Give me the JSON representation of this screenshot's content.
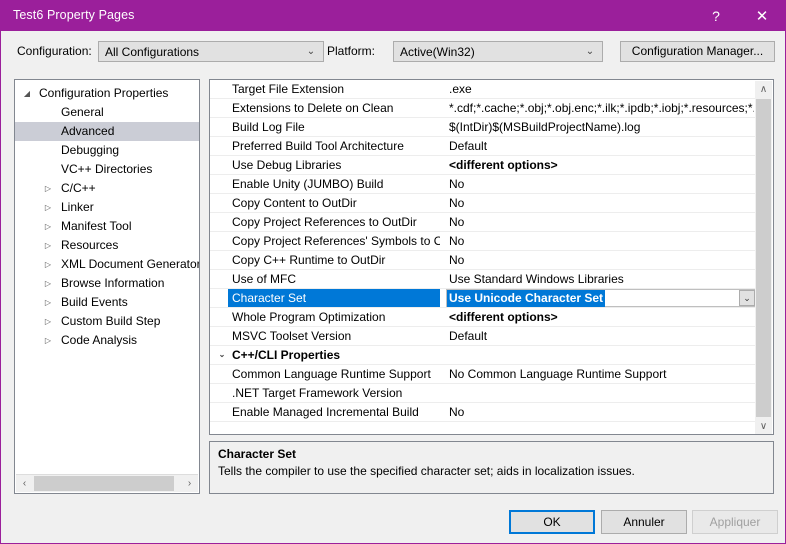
{
  "window": {
    "title": "Test6 Property Pages",
    "help_icon": "?",
    "close_icon": "✕",
    "accent_color": "#9B1F9B",
    "selection_color": "#0078D7"
  },
  "toolbar": {
    "configuration_label": "Configuration:",
    "configuration_value": "All Configurations",
    "platform_label": "Platform:",
    "platform_value": "Active(Win32)",
    "configuration_manager_label": "Configuration Manager...",
    "dropdown_arrow": "⌄"
  },
  "tree": {
    "items": [
      {
        "label": "Configuration Properties",
        "level": 0,
        "twisty": "◢",
        "selected": false
      },
      {
        "label": "General",
        "level": 1,
        "twisty": "",
        "selected": false
      },
      {
        "label": "Advanced",
        "level": 1,
        "twisty": "",
        "selected": true
      },
      {
        "label": "Debugging",
        "level": 1,
        "twisty": "",
        "selected": false
      },
      {
        "label": "VC++ Directories",
        "level": 1,
        "twisty": "",
        "selected": false
      },
      {
        "label": "C/C++",
        "level": 1,
        "twisty": "▷",
        "selected": false
      },
      {
        "label": "Linker",
        "level": 1,
        "twisty": "▷",
        "selected": false
      },
      {
        "label": "Manifest Tool",
        "level": 1,
        "twisty": "▷",
        "selected": false
      },
      {
        "label": "Resources",
        "level": 1,
        "twisty": "▷",
        "selected": false
      },
      {
        "label": "XML Document Generator",
        "level": 1,
        "twisty": "▷",
        "selected": false
      },
      {
        "label": "Browse Information",
        "level": 1,
        "twisty": "▷",
        "selected": false
      },
      {
        "label": "Build Events",
        "level": 1,
        "twisty": "▷",
        "selected": false
      },
      {
        "label": "Custom Build Step",
        "level": 1,
        "twisty": "▷",
        "selected": false
      },
      {
        "label": "Code Analysis",
        "level": 1,
        "twisty": "▷",
        "selected": false
      }
    ],
    "hscroll": {
      "left_arrow": "‹",
      "right_arrow": "›"
    }
  },
  "grid": {
    "rows": [
      {
        "name": "Target File Extension",
        "value": ".exe",
        "kind": "prop",
        "bold": false,
        "selected": false
      },
      {
        "name": "Extensions to Delete on Clean",
        "value": "*.cdf;*.cache;*.obj;*.obj.enc;*.ilk;*.ipdb;*.iobj;*.resources;*.t",
        "kind": "prop",
        "bold": false,
        "selected": false
      },
      {
        "name": "Build Log File",
        "value": "$(IntDir)$(MSBuildProjectName).log",
        "kind": "prop",
        "bold": false,
        "selected": false
      },
      {
        "name": "Preferred Build Tool Architecture",
        "value": "Default",
        "kind": "prop",
        "bold": false,
        "selected": false
      },
      {
        "name": "Use Debug Libraries",
        "value": "<different options>",
        "kind": "prop",
        "bold": true,
        "selected": false
      },
      {
        "name": "Enable Unity (JUMBO) Build",
        "value": "No",
        "kind": "prop",
        "bold": false,
        "selected": false
      },
      {
        "name": "Copy Content to OutDir",
        "value": "No",
        "kind": "prop",
        "bold": false,
        "selected": false
      },
      {
        "name": "Copy Project References to OutDir",
        "value": "No",
        "kind": "prop",
        "bold": false,
        "selected": false
      },
      {
        "name": "Copy Project References' Symbols to Ou",
        "value": "No",
        "kind": "prop",
        "bold": false,
        "selected": false
      },
      {
        "name": "Copy C++ Runtime to OutDir",
        "value": "No",
        "kind": "prop",
        "bold": false,
        "selected": false
      },
      {
        "name": "Use of MFC",
        "value": "Use Standard Windows Libraries",
        "kind": "prop",
        "bold": false,
        "selected": false
      },
      {
        "name": "Character Set",
        "value": "Use Unicode Character Set",
        "kind": "prop",
        "bold": true,
        "selected": true
      },
      {
        "name": "Whole Program Optimization",
        "value": "<different options>",
        "kind": "prop",
        "bold": true,
        "selected": false
      },
      {
        "name": "MSVC Toolset Version",
        "value": "Default",
        "kind": "prop",
        "bold": false,
        "selected": false
      },
      {
        "name": "C++/CLI Properties",
        "value": "",
        "kind": "group",
        "twisty": "⌄",
        "bold": true,
        "selected": false
      },
      {
        "name": "Common Language Runtime Support",
        "value": "No Common Language Runtime Support",
        "kind": "prop",
        "bold": false,
        "selected": false
      },
      {
        "name": ".NET Target Framework Version",
        "value": "",
        "kind": "prop",
        "bold": false,
        "selected": false
      },
      {
        "name": "Enable Managed Incremental Build",
        "value": "No",
        "kind": "prop",
        "bold": false,
        "selected": false
      }
    ],
    "editor_dropdown_arrow": "⌄",
    "vscroll": {
      "up_arrow": "∧",
      "down_arrow": "∨"
    }
  },
  "description": {
    "title": "Character Set",
    "text": "Tells the compiler to use the specified character set; aids in localization issues."
  },
  "buttons": {
    "ok": "OK",
    "cancel": "Annuler",
    "apply": "Appliquer"
  }
}
